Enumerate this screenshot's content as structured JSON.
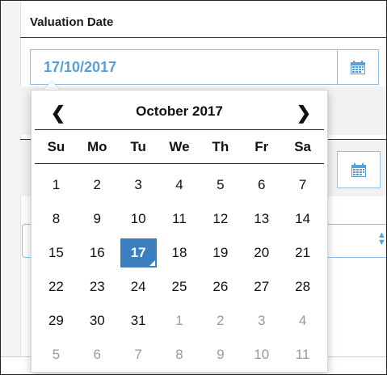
{
  "form": {
    "section_label": "Valuation Date",
    "date_value": "17/10/2017"
  },
  "calendar": {
    "month_title": "October 2017",
    "prev_symbol": "❮",
    "next_symbol": "❯",
    "weekdays": [
      "Su",
      "Mo",
      "Tu",
      "We",
      "Th",
      "Fr",
      "Sa"
    ],
    "weeks": [
      [
        {
          "d": "1"
        },
        {
          "d": "2"
        },
        {
          "d": "3"
        },
        {
          "d": "4"
        },
        {
          "d": "5"
        },
        {
          "d": "6"
        },
        {
          "d": "7"
        }
      ],
      [
        {
          "d": "8"
        },
        {
          "d": "9"
        },
        {
          "d": "10"
        },
        {
          "d": "11"
        },
        {
          "d": "12"
        },
        {
          "d": "13"
        },
        {
          "d": "14"
        }
      ],
      [
        {
          "d": "15"
        },
        {
          "d": "16"
        },
        {
          "d": "17",
          "selected": true
        },
        {
          "d": "18"
        },
        {
          "d": "19"
        },
        {
          "d": "20"
        },
        {
          "d": "21"
        }
      ],
      [
        {
          "d": "22"
        },
        {
          "d": "23"
        },
        {
          "d": "24"
        },
        {
          "d": "25"
        },
        {
          "d": "26"
        },
        {
          "d": "27"
        },
        {
          "d": "28"
        }
      ],
      [
        {
          "d": "29"
        },
        {
          "d": "30"
        },
        {
          "d": "31"
        },
        {
          "d": "1",
          "muted": true
        },
        {
          "d": "2",
          "muted": true
        },
        {
          "d": "3",
          "muted": true
        },
        {
          "d": "4",
          "muted": true
        }
      ],
      [
        {
          "d": "5",
          "muted": true
        },
        {
          "d": "6",
          "muted": true
        },
        {
          "d": "7",
          "muted": true
        },
        {
          "d": "8",
          "muted": true
        },
        {
          "d": "9",
          "muted": true
        },
        {
          "d": "10",
          "muted": true
        },
        {
          "d": "11",
          "muted": true
        }
      ]
    ]
  },
  "icons": {
    "calendar": "calendar-icon",
    "select_caret": "sort-caret-icon"
  },
  "colors": {
    "accent": "#5aa0d3",
    "border_accent": "#8fc1e6",
    "selected_day_bg": "#3b7fc1",
    "muted_text": "#9a9a9a"
  }
}
